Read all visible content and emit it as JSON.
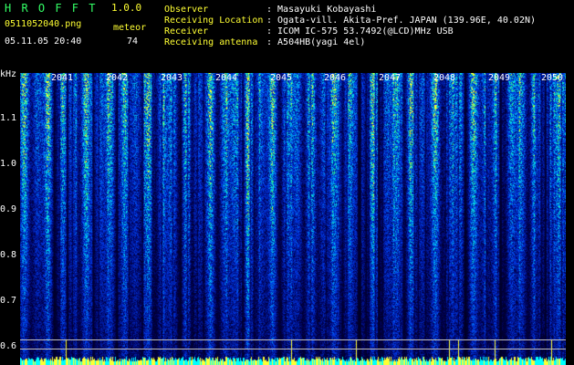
{
  "header": {
    "title": "H R O F F T",
    "version": "1.0.0",
    "filename": "0511052040.png",
    "mode": "meteor",
    "datetime": "05.11.05 20:40",
    "count": "74"
  },
  "info": {
    "observer_label": "Observer",
    "observer_value": ": Masayuki Kobayashi",
    "location_label": "Receiving Location",
    "location_value": ": Ogata-vill. Akita-Pref. JAPAN (139.96E, 40.02N)",
    "receiver_label": "Receiver",
    "receiver_value": ": ICOM IC-575 53.7492(@LCD)MHz USB",
    "antenna_label": "Receiving antenna",
    "antenna_value": ": A504HB(yagi 4el)"
  },
  "axis": {
    "y_unit": "kHz",
    "y_ticks": [
      "1.1",
      "1.0",
      "0.9",
      "0.8",
      "0.7",
      "0.6"
    ],
    "x_ticks": [
      "2041",
      "2042",
      "2043",
      "2044",
      "2045",
      "2046",
      "2047",
      "2048",
      "2049",
      "2050"
    ]
  },
  "colors": {
    "background": "#000000",
    "label_yellow": "#ffff33",
    "title_green": "#33ff66",
    "spectrum_dark": "#000033",
    "spectrum_blue": "#0033cc",
    "spectrum_cyan": "#00ccff",
    "spectrum_green": "#33ff66",
    "spectrum_yellow": "#ffff33"
  }
}
